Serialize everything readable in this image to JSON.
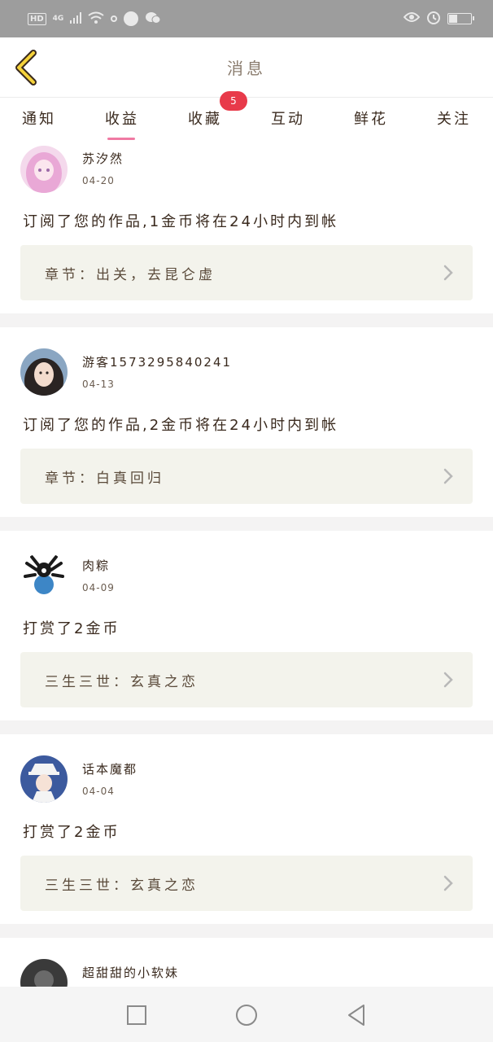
{
  "status_bar": {
    "hd": "HD",
    "network": "4G",
    "battery_percent": 35
  },
  "header": {
    "title": "消息"
  },
  "tabs": [
    {
      "label": "通知",
      "active": false
    },
    {
      "label": "收益",
      "active": true
    },
    {
      "label": "收藏",
      "active": false,
      "badge": "5"
    },
    {
      "label": "互动",
      "active": false
    },
    {
      "label": "鲜花",
      "active": false
    },
    {
      "label": "关注",
      "active": false
    }
  ],
  "feed": [
    {
      "user": "苏汐然",
      "date": "04-20",
      "message": "订阅了您的作品,1金币将在24小时内到帐",
      "work": "章节：出关，去昆仑虚",
      "avatar": "pink-hair-girl"
    },
    {
      "user": "游客1573295840241",
      "date": "04-13",
      "message": "订阅了您的作品,2金币将在24小时内到帐",
      "work": "章节：白真回归",
      "avatar": "girl-portrait"
    },
    {
      "user": "肉粽",
      "date": "04-09",
      "message": "打赏了2金币",
      "work": "三生三世：玄真之恋",
      "avatar": "panda-meme"
    },
    {
      "user": "话本魔都",
      "date": "04-04",
      "message": "打赏了2金币",
      "work": "三生三世：玄真之恋",
      "avatar": "anime-boy"
    },
    {
      "user": "超甜甜的小软妹",
      "avatar": "dark-avatar"
    }
  ],
  "colors": {
    "accent_pink": "#f07aa3",
    "badge_red": "#e83a4a",
    "card_box": "#f3f3ec",
    "status_bar": "#9d9d9d"
  }
}
